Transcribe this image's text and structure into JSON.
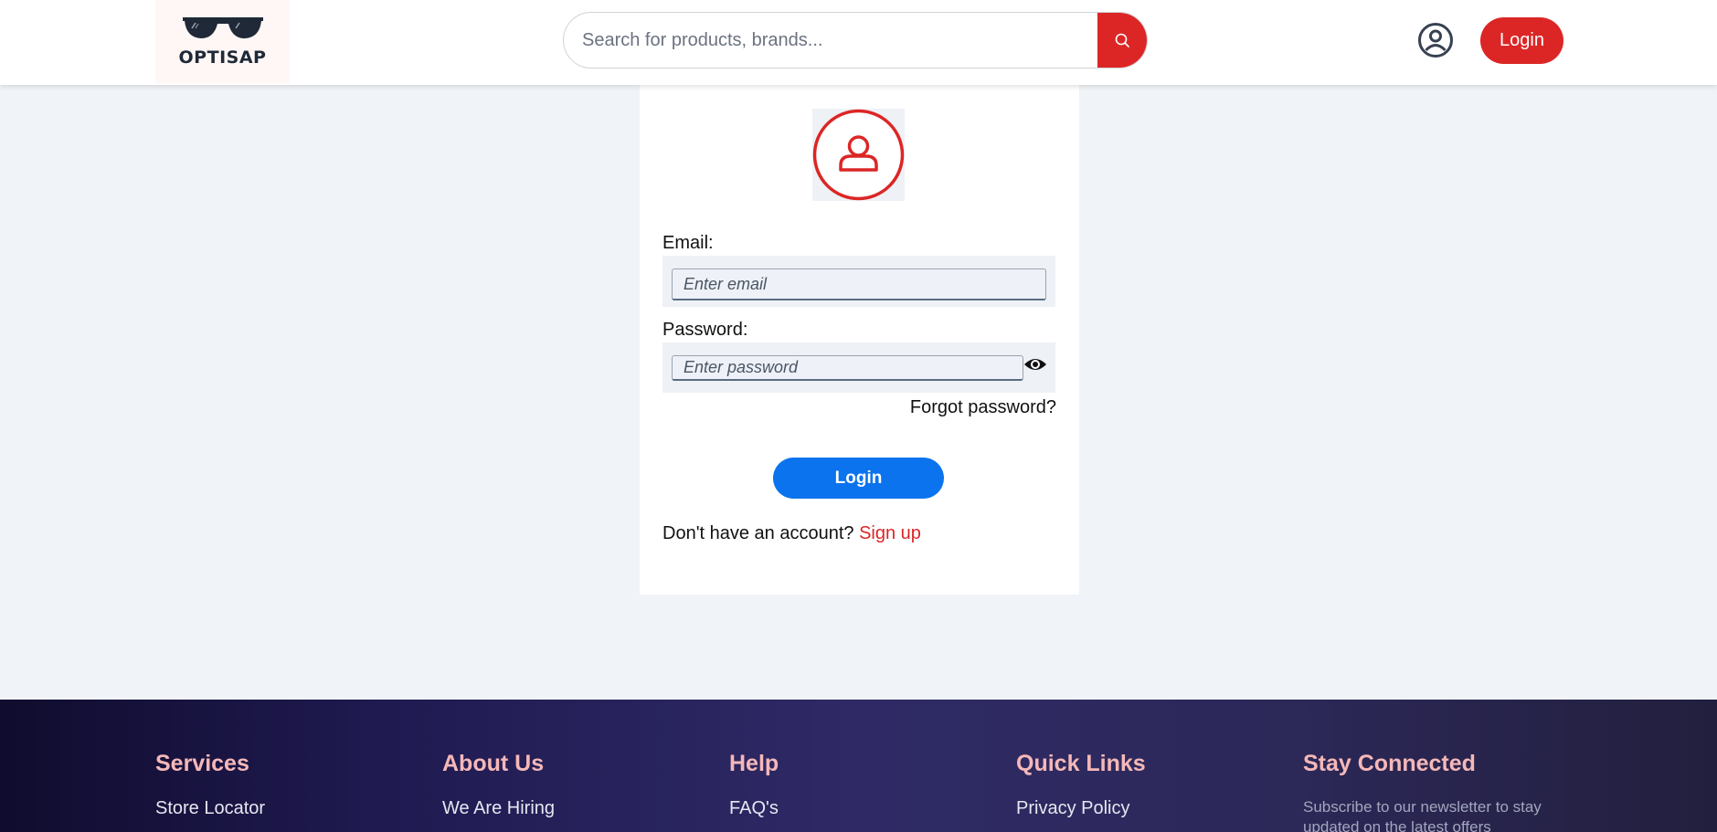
{
  "header": {
    "logo_text": "OPTISAP",
    "search_placeholder": "Search for products, brands...",
    "login_label": "Login"
  },
  "login_form": {
    "email_label": "Email:",
    "email_placeholder": "Enter email",
    "password_label": "Password:",
    "password_placeholder": "Enter password",
    "forgot_password": "Forgot password?",
    "submit_label": "Login",
    "no_account_text": "Don't have an account?",
    "signup_link": "Sign up"
  },
  "footer": {
    "columns": [
      {
        "title": "Services",
        "first_link": "Store Locator"
      },
      {
        "title": "About Us",
        "first_link": "We Are Hiring"
      },
      {
        "title": "Help",
        "first_link": "FAQ's"
      },
      {
        "title": "Quick Links",
        "first_link": "Privacy Policy"
      },
      {
        "title": "Stay Connected",
        "text": "Subscribe to our newsletter to stay updated on the latest offers"
      }
    ]
  },
  "colors": {
    "accent_red": "#dc2626",
    "primary_blue": "#0b73ee",
    "footer_title": "#f5b8b8",
    "page_background": "#f0f3f7"
  },
  "icons": [
    "sunglasses-icon",
    "search-icon",
    "user-circle-icon",
    "avatar-icon",
    "eye-icon"
  ]
}
